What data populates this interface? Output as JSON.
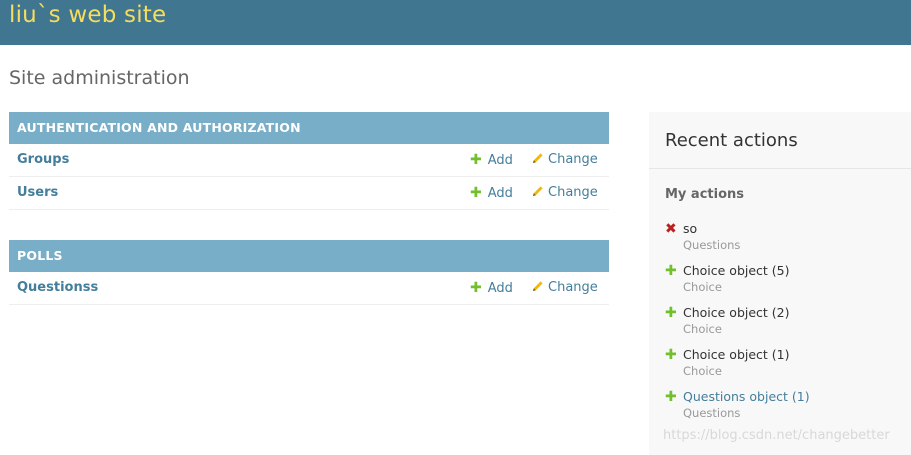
{
  "header": {
    "site_title": "liu`s web site"
  },
  "page_title": "Site administration",
  "modules": [
    {
      "caption": "AUTHENTICATION AND AUTHORIZATION",
      "rows": [
        {
          "name": "Groups",
          "add_label": "Add",
          "change_label": "Change"
        },
        {
          "name": "Users",
          "add_label": "Add",
          "change_label": "Change"
        }
      ]
    },
    {
      "caption": "POLLS",
      "rows": [
        {
          "name": "Questionss",
          "add_label": "Add",
          "change_label": "Change"
        }
      ]
    }
  ],
  "sidebar": {
    "title": "Recent actions",
    "subtitle": "My actions",
    "actions": [
      {
        "icon": "delete-icon",
        "title": "so",
        "type": "Questions"
      },
      {
        "icon": "add-icon",
        "title": "Choice object (5)",
        "type": "Choice"
      },
      {
        "icon": "add-icon",
        "title": "Choice object (2)",
        "type": "Choice"
      },
      {
        "icon": "add-icon",
        "title": "Choice object (1)",
        "type": "Choice"
      },
      {
        "icon": "add-icon",
        "title": "Questions object (1)",
        "type": "Questions"
      }
    ]
  },
  "watermark": "https://blog.csdn.net/changebetter",
  "colors": {
    "header_bg": "#417690",
    "site_title": "#f5dd5d",
    "caption_bg": "#79aec8",
    "link": "#447e9b",
    "add_icon": "#70bf2b",
    "delete_icon": "#ba2121"
  }
}
